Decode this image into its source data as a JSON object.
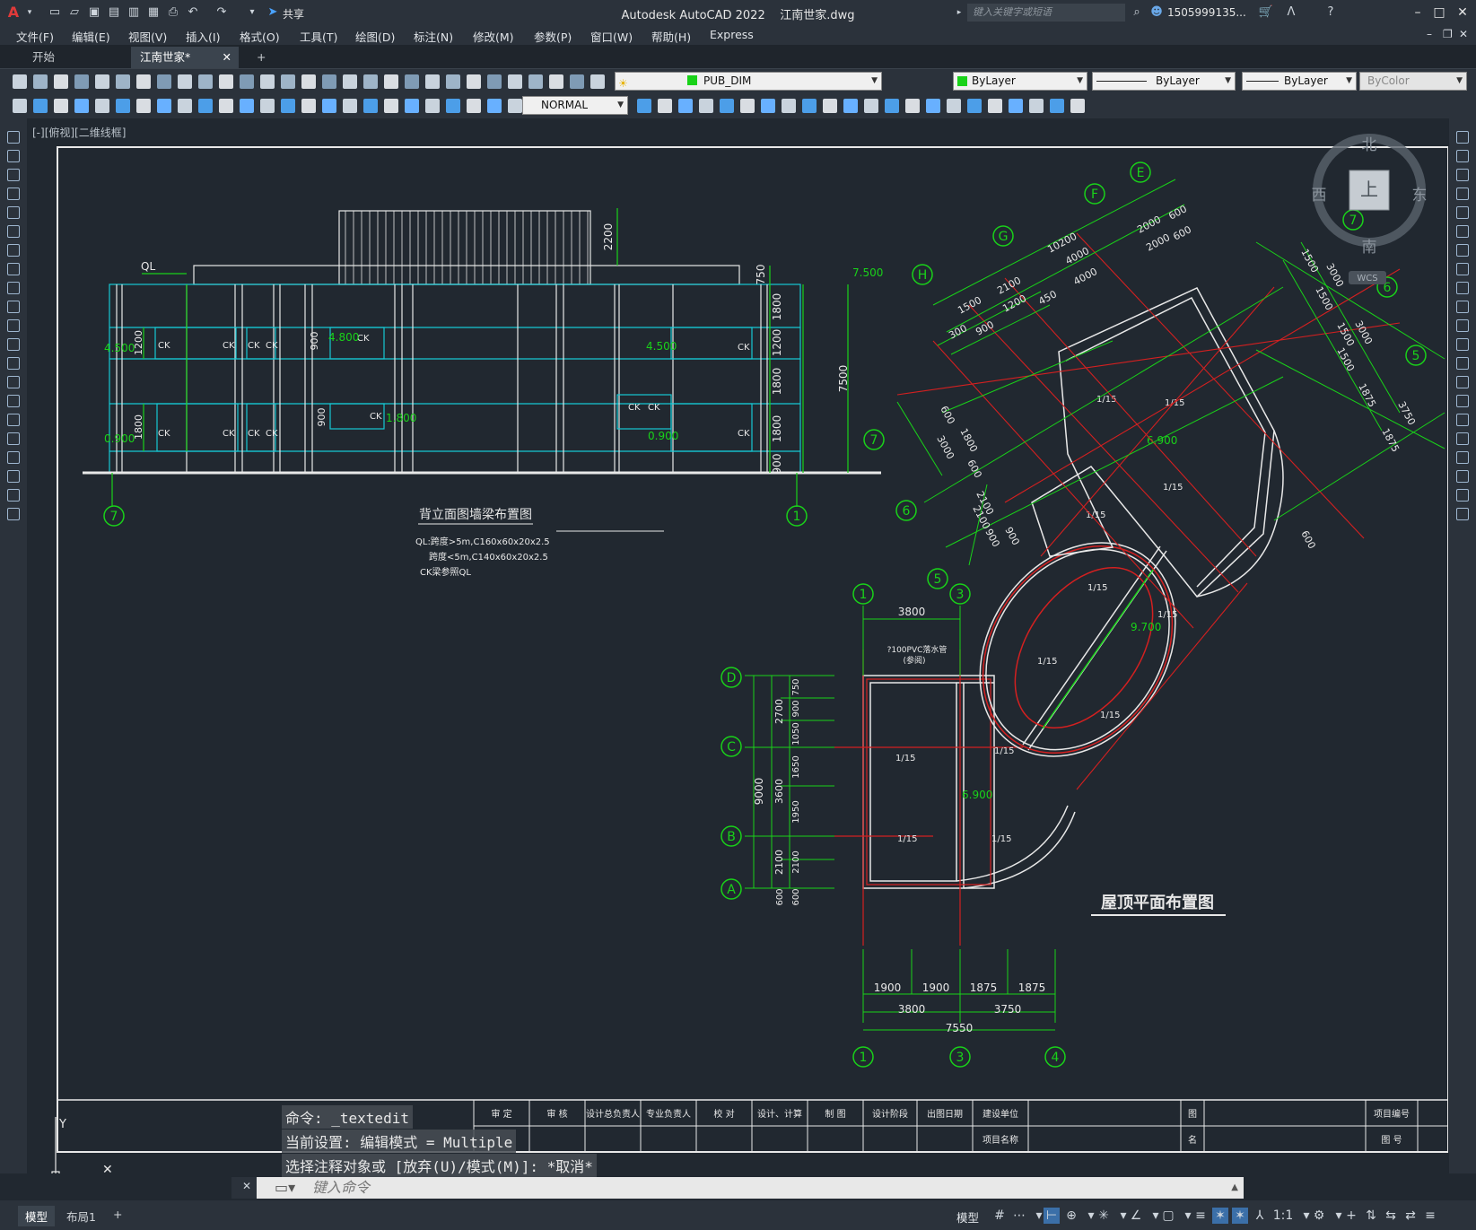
{
  "app": {
    "title": "Autodesk AutoCAD 2022",
    "file": "江南世家.dwg",
    "share_label": "共享",
    "search_placeholder": "键入关键字或短语",
    "user": "1505999135...",
    "logo": "A"
  },
  "menu": [
    "文件(F)",
    "编辑(E)",
    "视图(V)",
    "插入(I)",
    "格式(O)",
    "工具(T)",
    "绘图(D)",
    "标注(N)",
    "修改(M)",
    "参数(P)",
    "窗口(W)",
    "帮助(H)",
    "Express"
  ],
  "tabs": [
    {
      "label": "开始",
      "active": false
    },
    {
      "label": "江南世家*",
      "active": true
    }
  ],
  "toolbar": {
    "layer": "PUB_DIM",
    "color": "ByLayer",
    "linetype": "ByLayer",
    "lineweight": "ByLayer",
    "plotstyle": "ByColor",
    "textstyle": "NORMAL"
  },
  "viewport_label": "[-][俯视][二维线框]",
  "viewcube": {
    "north": "北",
    "south": "南",
    "east": "东",
    "west": "西",
    "top": "上",
    "wcs": "WCS"
  },
  "drawing": {
    "elevation_title": "背立面图墙梁布置图",
    "elevation_notes": [
      "QL:跨度>5m,C160x60x20x2.5",
      "跨度<5m,C140x60x20x2.5",
      "CK梁参照QL"
    ],
    "roof_title": "屋顶平面布置图",
    "ql_label": "QL",
    "ck_label": "CK",
    "pipe_note": "?100PVC落水管",
    "pipe_note2": "(参阅)",
    "elev_levels": [
      "7.500",
      "4.800",
      "4.500",
      "1.800",
      "0.900",
      "0.900",
      "4.500"
    ],
    "elev_right_dims": [
      "750",
      "1800",
      "1200",
      "1800",
      "1800",
      "900",
      "7500"
    ],
    "elev_top_dim": "2200",
    "elev_left_dims": [
      "1200",
      "1800",
      "900",
      "900"
    ],
    "elev_axes": [
      "7",
      "1"
    ],
    "plan_axes_top": [
      "1",
      "3"
    ],
    "plan_axes_bottom": [
      "1",
      "3",
      "4"
    ],
    "plan_axes_left": [
      "D",
      "C",
      "B",
      "A"
    ],
    "plan_dim_top": "3800",
    "plan_dims_bottom_1": [
      "1900",
      "1900",
      "1875",
      "1875"
    ],
    "plan_dims_bottom_2": [
      "3800",
      "3750"
    ],
    "plan_dims_bottom_3": "7550",
    "plan_dims_left_outer": [
      "9000"
    ],
    "plan_dims_left_mid": [
      "2700",
      "3600",
      "2100"
    ],
    "plan_dims_left_inner": [
      "750",
      "900",
      "1050",
      "1650",
      "1950",
      "2100",
      "600",
      "600"
    ],
    "plan_levels": [
      "6.900",
      "6.900",
      "9.700"
    ],
    "slope": "1/15",
    "rot_axes": [
      "E",
      "F",
      "G",
      "H",
      "7",
      "6",
      "5",
      "7",
      "6",
      "5"
    ],
    "rot_dims_top": [
      "10200",
      "4000",
      "4000",
      "2000",
      "2000",
      "600",
      "600",
      "2100",
      "1500",
      "450",
      "1200",
      "300",
      "900"
    ],
    "rot_dims_right": [
      "1500",
      "3000",
      "1500",
      "1500",
      "3000",
      "1500",
      "1875",
      "3750",
      "1875",
      "600"
    ],
    "rot_dims_left": [
      "600",
      "1800",
      "3000",
      "600",
      "2100",
      "2100",
      "900",
      "900"
    ]
  },
  "title_block": {
    "headers": [
      "审  定",
      "审  核",
      "设计总负责人",
      "专业负责人",
      "校  对",
      "设计、计算",
      "制  图",
      "设计阶段",
      "出图日期",
      "建设单位",
      "图",
      "项目编号"
    ],
    "row2": [
      "项目名称",
      "名",
      "图  号"
    ]
  },
  "command": {
    "lines": [
      "命令: _textedit",
      "当前设置: 编辑模式 = Multiple",
      "选择注释对象或 [放弃(U)/模式(M)]: *取消*"
    ],
    "placeholder": "键入命令"
  },
  "layouts": [
    {
      "label": "模型",
      "active": true
    },
    {
      "label": "布局1",
      "active": false
    }
  ],
  "status": {
    "model": "模型",
    "scale": "1:1"
  },
  "colors": {
    "bg": "#212830",
    "green": "#19d219",
    "cyan": "#16c8d4",
    "red": "#d42020",
    "white": "#e8e8e8"
  }
}
